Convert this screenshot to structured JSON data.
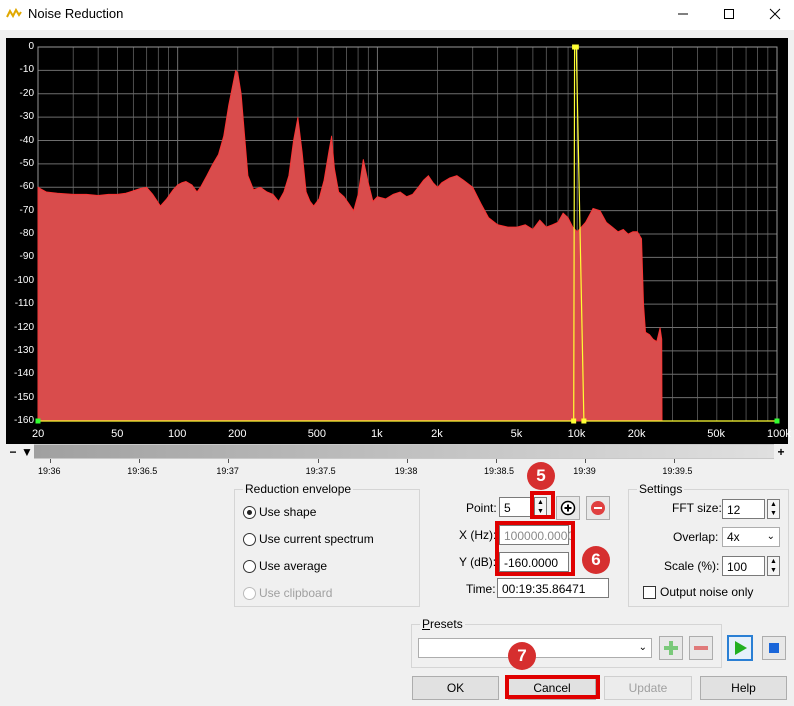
{
  "window": {
    "title": "Noise Reduction",
    "minimize_icon": "minimize-icon",
    "maximize_icon": "maximize-icon",
    "close_icon": "close-icon"
  },
  "spectrum": {
    "y_labels": [
      "0",
      "-10",
      "-20",
      "-30",
      "-40",
      "-50",
      "-60",
      "-70",
      "-80",
      "-90",
      "-100",
      "-110",
      "-120",
      "-130",
      "-140",
      "-150",
      "-160"
    ],
    "x_labels": [
      "20",
      "50",
      "100",
      "200",
      "500",
      "1k",
      "2k",
      "5k",
      "10k",
      "20k",
      "50k",
      "100k"
    ],
    "x_values": [
      20,
      50,
      100,
      200,
      500,
      1000,
      2000,
      5000,
      10000,
      20000,
      50000,
      100000
    ],
    "fill_color": "#d94c4c",
    "envelope_color": "#ffff33",
    "grid_color": "#6e6e6e"
  },
  "scrollbar": {
    "minus_label": "−",
    "down_label": "▼",
    "plus_label": "+"
  },
  "time_ruler": [
    "19:36",
    "19:36.5",
    "19:37",
    "19:37.5",
    "19:38",
    "19:38.5",
    "19:39",
    "19:39.5"
  ],
  "reduction_envelope": {
    "title": "Reduction envelope",
    "options": [
      {
        "label": "Use shape",
        "checked": true,
        "enabled": true
      },
      {
        "label": "Use current spectrum",
        "checked": false,
        "enabled": true
      },
      {
        "label": "Use average",
        "checked": false,
        "enabled": true
      },
      {
        "label": "Use clipboard",
        "checked": false,
        "enabled": false
      }
    ]
  },
  "point": {
    "label": "Point:",
    "value": "5",
    "add_icon": "plus-circle-icon",
    "remove_icon": "minus-circle-icon"
  },
  "x_hz": {
    "label": "X (Hz):",
    "value": "100000.0000"
  },
  "y_db": {
    "label": "Y (dB):",
    "value": "-160.0000"
  },
  "time": {
    "label": "Time:",
    "value": "00:19:35.86471"
  },
  "settings": {
    "title": "Settings",
    "fft_label": "FFT size:",
    "fft_value": "12",
    "overlap_label": "Overlap:",
    "overlap_value": "4x",
    "scale_label": "Scale (%):",
    "scale_value": "100",
    "output_noise_label": "Output noise only"
  },
  "presets": {
    "title": "Presets",
    "value": "",
    "add_icon": "plus-icon",
    "remove_icon": "minus-icon",
    "play_icon": "play-icon",
    "stop_icon": "stop-icon"
  },
  "buttons": {
    "ok": "OK",
    "cancel": "Cancel",
    "update": "Update",
    "help": "Help"
  },
  "annotations": {
    "m5": "5",
    "m6": "6",
    "m7": "7"
  }
}
